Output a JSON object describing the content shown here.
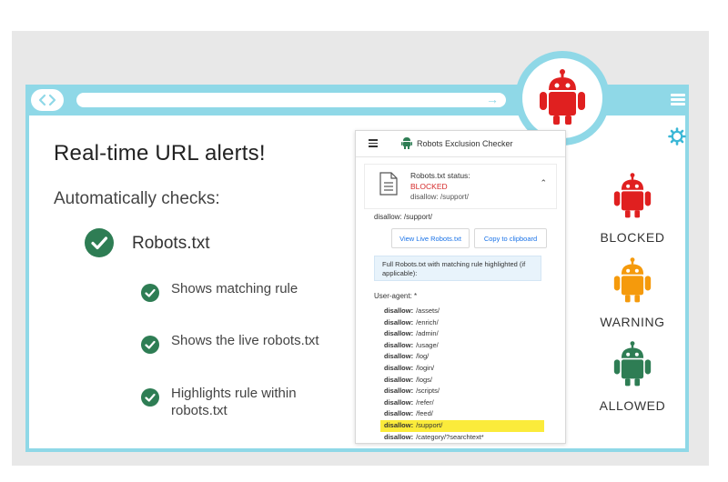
{
  "colors": {
    "frame": "#8fd8e7",
    "blocked": "#e02020",
    "warning": "#f59a0c",
    "allowed": "#2e7d54",
    "highlight": "#fbeb3b",
    "link": "#1a73e8"
  },
  "browser": {
    "nav_icon": "back-forward-icon",
    "url_arrow": "→",
    "menu_icon": "hamburger-icon",
    "settings_icon": "gear-icon"
  },
  "left": {
    "headline": "Real-time URL alerts!",
    "subhead": "Automatically checks:",
    "main_item": "Robots.txt",
    "features": [
      "Shows matching rule",
      "Shows the live robots.txt",
      "Highlights rule within robots.txt"
    ]
  },
  "panel": {
    "title": "Robots Exclusion Checker",
    "status_title": "Robots.txt status:",
    "status_value": "BLOCKED",
    "status_rule": "disallow: /support/",
    "disallow_line": "disallow: /support/",
    "view_button": "View Live Robots.txt",
    "copy_button": "Copy to clipboard",
    "info_text": "Full Robots.txt with matching rule highlighted (if applicable):",
    "user_agent": "User-agent: *",
    "rules": [
      {
        "key": "disallow:",
        "path": "/assets/",
        "highlight": false
      },
      {
        "key": "disallow:",
        "path": "/enrich/",
        "highlight": false
      },
      {
        "key": "disallow:",
        "path": "/admin/",
        "highlight": false
      },
      {
        "key": "disallow:",
        "path": "/usage/",
        "highlight": false
      },
      {
        "key": "disallow:",
        "path": "/log/",
        "highlight": false
      },
      {
        "key": "disallow:",
        "path": "/login/",
        "highlight": false
      },
      {
        "key": "disallow:",
        "path": "/logs/",
        "highlight": false
      },
      {
        "key": "disallow:",
        "path": "/scripts/",
        "highlight": false
      },
      {
        "key": "disallow:",
        "path": "/refer/",
        "highlight": false
      },
      {
        "key": "disallow:",
        "path": "/feed/",
        "highlight": false
      },
      {
        "key": "disallow:",
        "path": "/support/",
        "highlight": true
      },
      {
        "key": "disallow:",
        "path": "/category/?searchtext*",
        "highlight": false
      }
    ]
  },
  "statuses": [
    {
      "label": "BLOCKED",
      "icon": "robot-blocked-icon"
    },
    {
      "label": "WARNING",
      "icon": "robot-warning-icon"
    },
    {
      "label": "ALLOWED",
      "icon": "robot-allowed-icon"
    }
  ]
}
